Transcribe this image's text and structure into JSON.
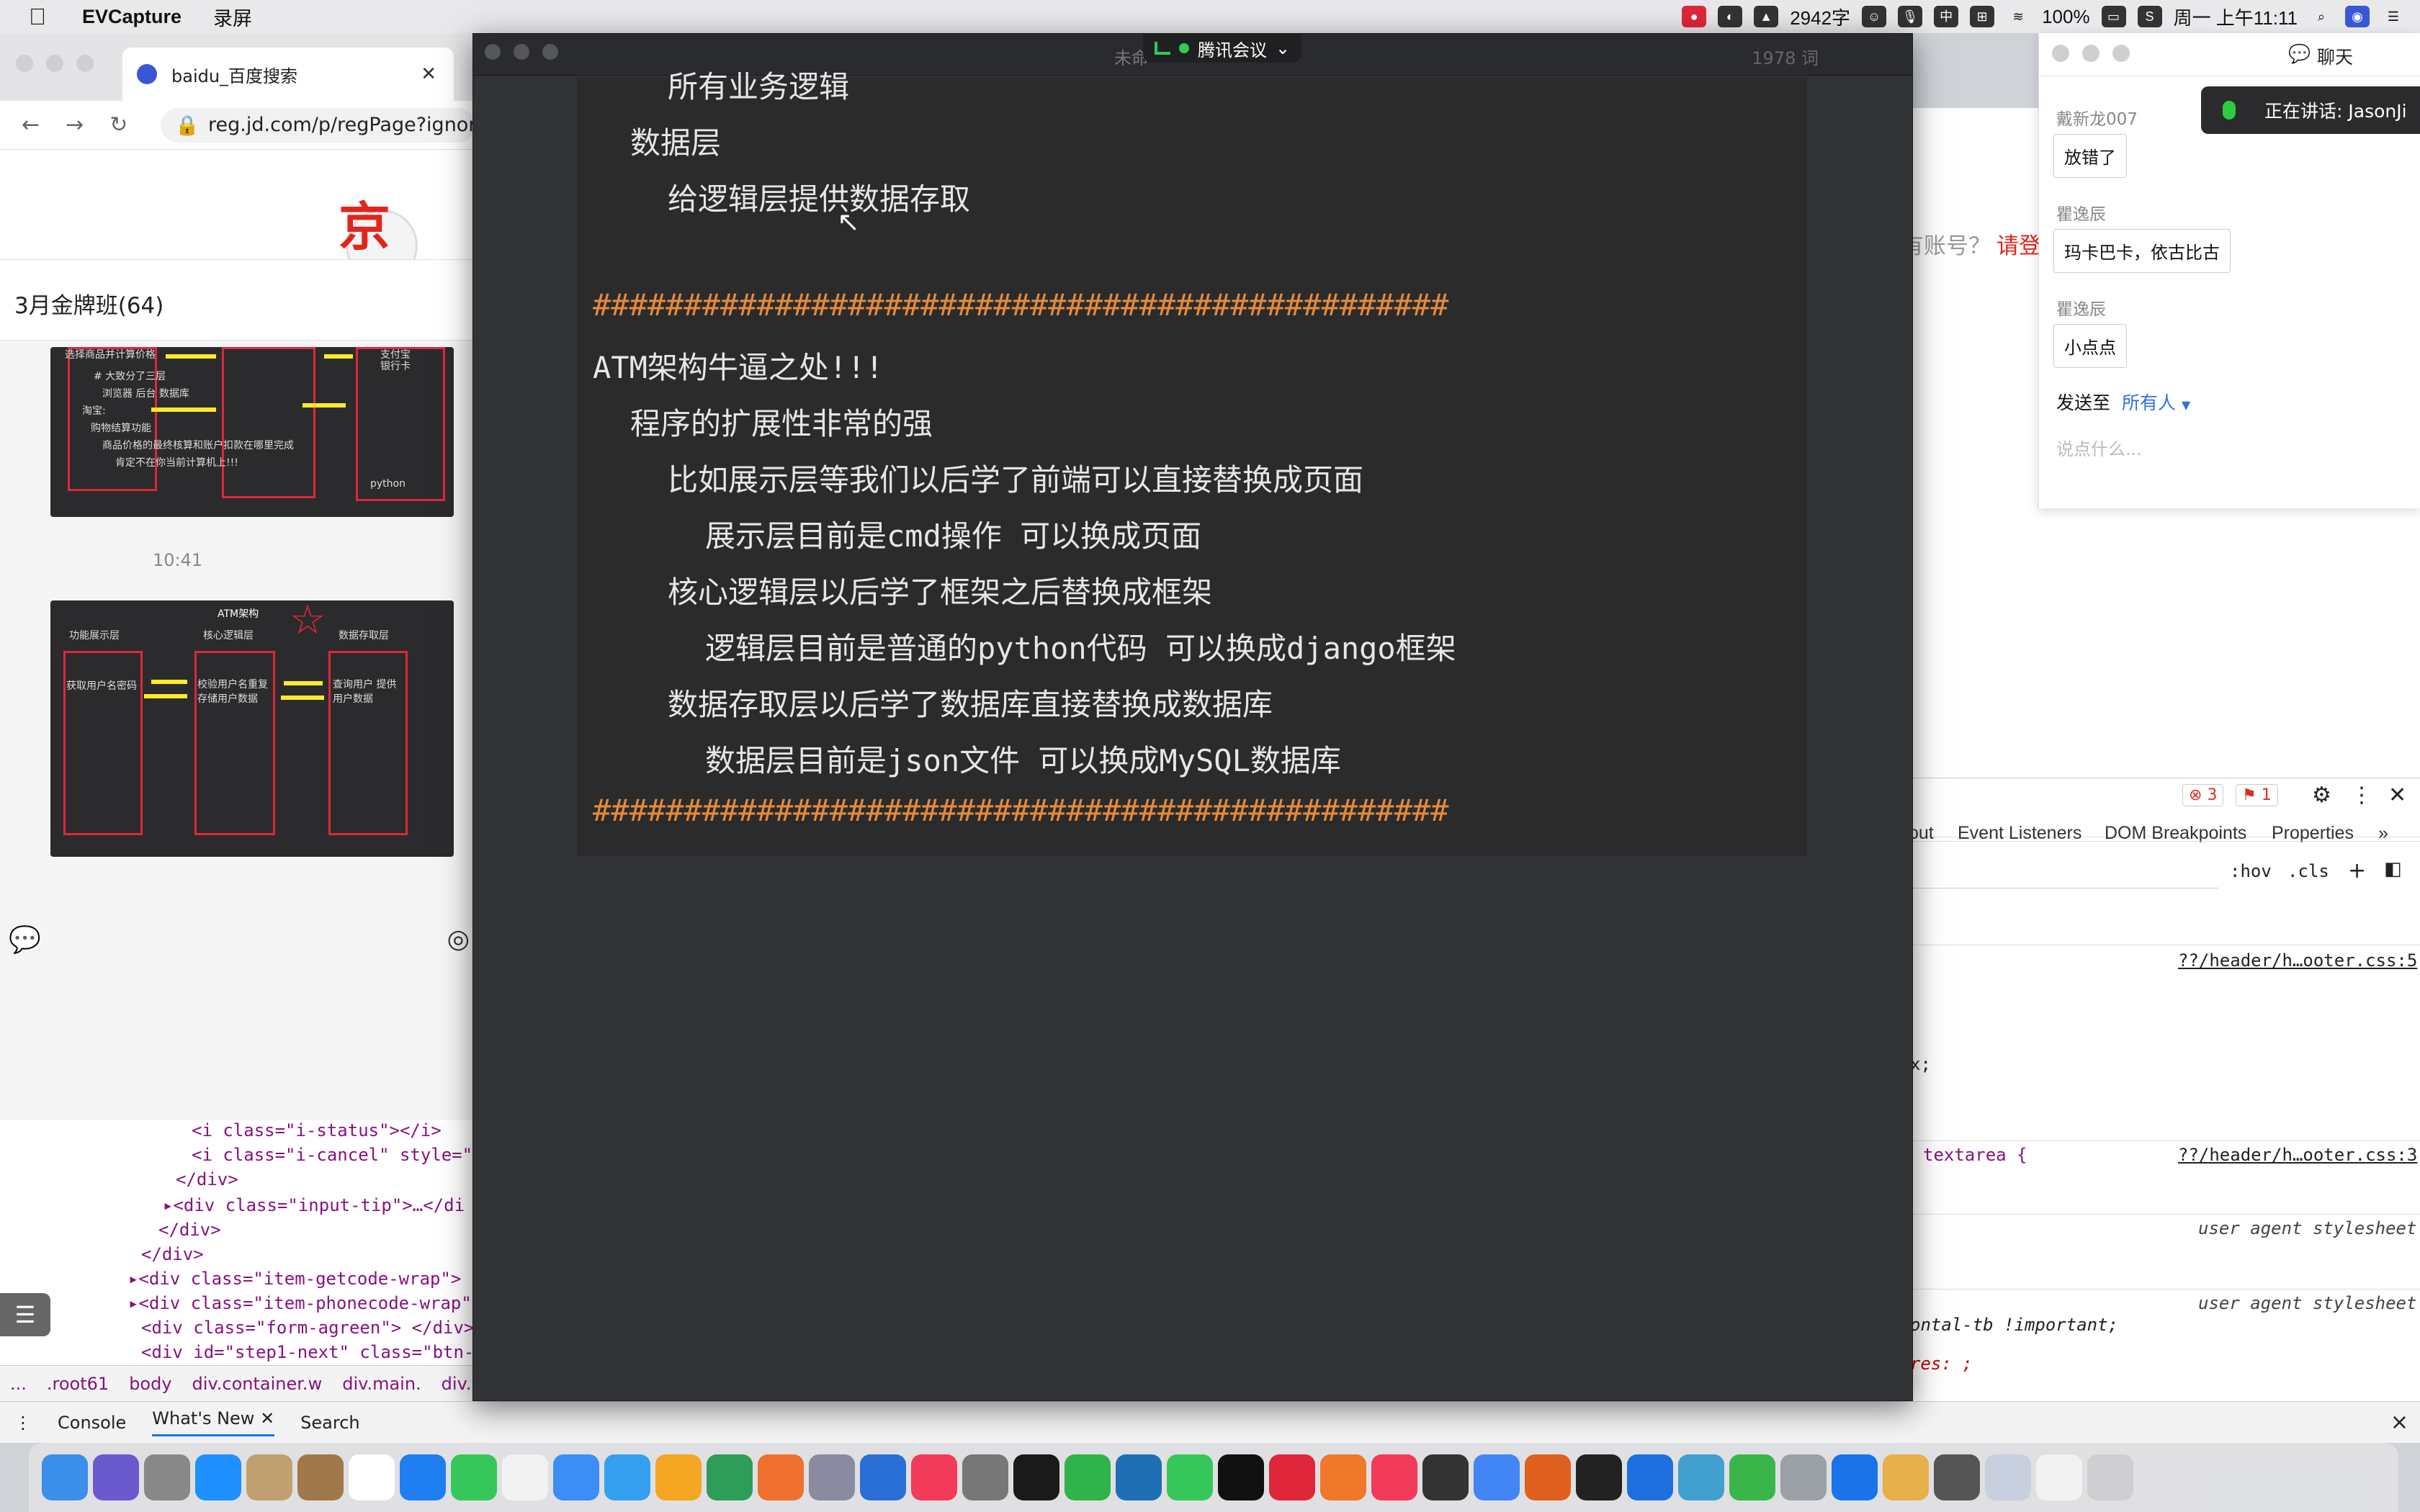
{
  "menubar": {
    "app": "EVCapture",
    "menu1": "录屏",
    "word_count": "2942字",
    "ime": "中",
    "battery": "100%",
    "clock": "周一 上午11:11"
  },
  "browser": {
    "tab_title": "baidu_百度搜索",
    "url": "reg.jd.com/p/regPage?ignore",
    "logo_text": "京",
    "no_account": "有账号？",
    "login": "请登"
  },
  "group_chat": {
    "title": "3月金牌班(64)",
    "timestamp": "10:41",
    "thumb1": {
      "texts": [
        "选择商品并计算价格",
        "# 大致分了三层",
        "浏览器  后台  数据库",
        "淘宝:",
        "购物结算功能",
        "商品价格的最终核算和账户扣款在哪里完成",
        "肯定不在你当前计算机上!!!",
        "python",
        "支付宝",
        "银行卡"
      ]
    },
    "thumb2": {
      "title": "ATM架构",
      "col1_head": "功能展示层",
      "col2_head": "核心逻辑层",
      "col3_head": "数据存取层",
      "col1_box": "获取用户名密码",
      "col2_box": "校验用户名重复 存储用户数据",
      "col3_box": "查询用户 提供用户数据"
    }
  },
  "devtools_left": {
    "lines": [
      "<i class=\"i-status\"></i>",
      "<i class=\"i-cancel\" style=\"",
      "</div>",
      "▸<div class=\"input-tip\">…</di",
      "</div>",
      "</div>",
      "▸<div class=\"item-getcode-wrap\">",
      "▸<div class=\"item-phonecode-wrap\"",
      "<div class=\"form-agreen\"> </div>",
      "<div id=\"step1-next\" class=\"btn-"
    ],
    "crumbs": [
      "...",
      ".root61",
      "body",
      "div.container.w",
      "div.main.",
      "div.reg-fo"
    ]
  },
  "devtools_bottom": {
    "tabs": [
      "Console",
      "What's New",
      "Search"
    ],
    "close": "×"
  },
  "devtools_right": {
    "errors": "3",
    "warnings": "1",
    "tabs": [
      "out",
      "Event Listeners",
      "DOM Breakpoints",
      "Properties",
      "»"
    ],
    "hov": ":hov",
    "cls": ".cls",
    "css_lines": [
      {
        "text": "??/header/h…ooter.css:5",
        "kind": "link"
      },
      {
        "text": "x;",
        "kind": "code"
      },
      {
        "text": "textarea {",
        "kind": "code"
      },
      {
        "text": "??/header/h…ooter.css:3",
        "kind": "link"
      },
      {
        "text": "user agent stylesheet",
        "kind": "ua"
      },
      {
        "text": "user agent stylesheet",
        "kind": "ua"
      },
      {
        "text": "ontal-tb !important;",
        "kind": "code"
      },
      {
        "text": "res: ;",
        "kind": "code"
      }
    ]
  },
  "chat": {
    "title": "聊天",
    "messages": [
      {
        "sender": "戴新龙007",
        "text": "放错了"
      },
      {
        "sender": "瞿逸辰",
        "text": "玛卡巴卡，依古比古"
      },
      {
        "sender": "瞿逸辰",
        "text": "小点点"
      }
    ],
    "send_to_label": "发送至",
    "send_to_target": "所有人",
    "input_placeholder": "说点什么..."
  },
  "speaking": "正在讲话: JasonJi",
  "editor": {
    "filename": "未命",
    "meeting": "腾讯会议",
    "word_count": "1978 词",
    "lines": [
      {
        "text": "所有业务逻辑",
        "indent": 2,
        "kind": "text"
      },
      {
        "text": "数据层",
        "indent": 1,
        "kind": "text"
      },
      {
        "text": "给逻辑层提供数据存取",
        "indent": 2,
        "kind": "text"
      },
      {
        "text": "",
        "indent": 0,
        "kind": "blank"
      },
      {
        "text": "###############################################",
        "indent": 0,
        "kind": "hash"
      },
      {
        "text": "ATM架构牛逼之处!!!",
        "indent": 0,
        "kind": "text"
      },
      {
        "text": "程序的扩展性非常的强",
        "indent": 1,
        "kind": "text"
      },
      {
        "text": "比如展示层等我们以后学了前端可以直接替换成页面",
        "indent": 2,
        "kind": "text"
      },
      {
        "text": "展示层目前是cmd操作  可以换成页面",
        "indent": 3,
        "kind": "text"
      },
      {
        "text": "核心逻辑层以后学了框架之后替换成框架",
        "indent": 2,
        "kind": "text"
      },
      {
        "text": "逻辑层目前是普通的python代码  可以换成django框架",
        "indent": 3,
        "kind": "text"
      },
      {
        "text": "数据存取层以后学了数据库直接替换成数据库",
        "indent": 2,
        "kind": "text"
      },
      {
        "text": "数据层目前是json文件  可以换成MySQL数据库",
        "indent": 3,
        "kind": "text"
      },
      {
        "text": "###############################################",
        "indent": 0,
        "kind": "hash"
      }
    ]
  },
  "dock": {
    "colors": [
      "#3b8fe8",
      "#6a5acd",
      "#888888",
      "#1e90ff",
      "#c0a070",
      "#a0784a",
      "#ffffff",
      "#1f7ef0",
      "#35c759",
      "#f2f2f2",
      "#3a8ef5",
      "#35a0f0",
      "#f5a623",
      "#2e9d5a",
      "#f07030",
      "#8a8aa0",
      "#2a6fd6",
      "#f23a5a",
      "#777777",
      "#1a1a1a",
      "#2fb34a",
      "#1f6fb5",
      "#35c759",
      "#111111",
      "#e0263a",
      "#f0782a",
      "#f23a5a",
      "#333333",
      "#4285f4",
      "#e06020",
      "#222222",
      "#1e6fe0",
      "#41a0d0",
      "#3ab54a",
      "#9aa0a6",
      "#1a73e8",
      "#e8b04a",
      "#555555",
      "#c8d0e0",
      "#f2f2f2",
      "#cfcfd2"
    ]
  }
}
